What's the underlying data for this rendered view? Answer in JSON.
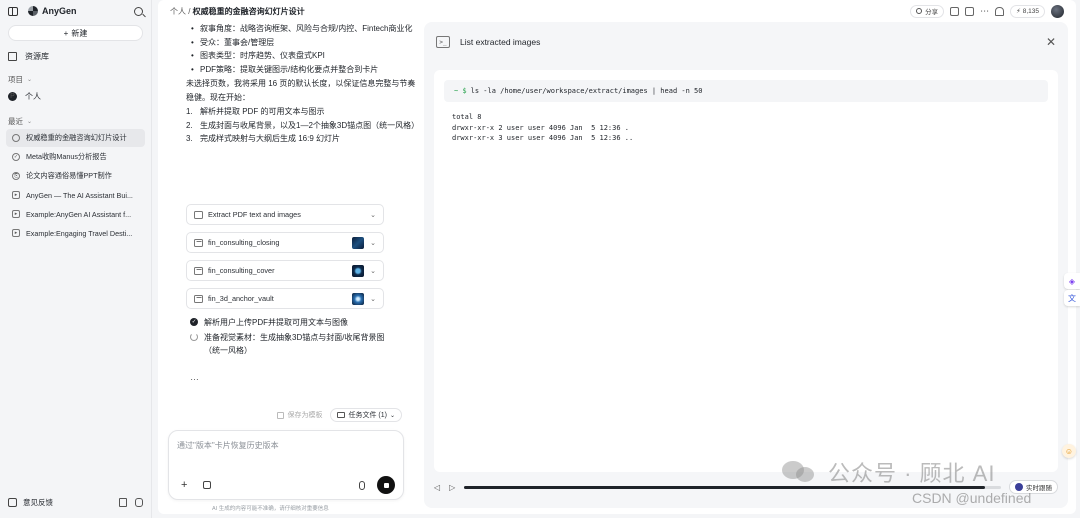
{
  "sidebar": {
    "brand": "AnyGen",
    "new_label": "新建",
    "library_label": "资源库",
    "projects_label": "项目",
    "personal_label": "个人",
    "recent_label": "最近",
    "recent_items": [
      {
        "label": "权威稳重的金融咨询幻灯片设计",
        "active": true
      },
      {
        "label": "Meta收购Manus分析报告"
      },
      {
        "label": "论文内容通俗易懂PPT制作"
      },
      {
        "label": "AnyGen — The AI Assistant Bui..."
      },
      {
        "label": "Example:AnyGen AI Assistant f..."
      },
      {
        "label": "Example:Engaging Travel Desti..."
      }
    ],
    "feedback_label": "意见反馈"
  },
  "header": {
    "breadcrumb_parent": "个人",
    "breadcrumb_sep": " / ",
    "breadcrumb_current": "权威稳重的金融咨询幻灯片设计",
    "share_label": "分享",
    "credits": "8,135"
  },
  "chat": {
    "bullets": [
      "叙事角度：战略咨询框架、风险与合规/内控、Fintech商业化",
      "受众：董事会/管理层",
      "图表类型：时序趋势、仪表盘式KPI",
      "PDF策略：提取关键图示/结构化要点并整合到卡片"
    ],
    "paragraph": "未选择页数，我将采用 16 页的默认长度，以保证信息完整与节奏稳健。现在开始：",
    "steps": [
      {
        "n": "1.",
        "text": "解析并提取 PDF 的可用文本与图示"
      },
      {
        "n": "2.",
        "text": "生成封面与收尾背景，以及1—2个抽象3D锚点图（统一风格）"
      },
      {
        "n": "3.",
        "text": "完成样式映射与大纲后生成 16:9 幻灯片"
      }
    ],
    "tool_cards": [
      {
        "label": "Extract PDF text and images",
        "icon": "terminal-icon"
      },
      {
        "label": "fin_consulting_closing",
        "icon": "image-icon"
      },
      {
        "label": "fin_consulting_cover",
        "icon": "image-icon"
      },
      {
        "label": "fin_3d_anchor_vault",
        "icon": "image-icon"
      }
    ],
    "progress": [
      {
        "text": "解析用户上传PDF并提取可用文本与图像",
        "status": "done"
      },
      {
        "text": "准备视觉素材：生成抽象3D锚点与封面/收尾背景图（统一风格）",
        "status": "in-progress"
      }
    ],
    "ellipsis": "…",
    "save_template": "保存为模板",
    "task_files": "任务文件 (1)",
    "composer_placeholder": "通过\"版本\"卡片恢复历史版本",
    "disclaimer": "AI 生成的内容可能不准确，请仔细核对重要信息"
  },
  "panel": {
    "title": "List extracted images",
    "prompt": "~ $",
    "command": "ls -la /home/user/workspace/extract/images | head -n 50",
    "output_lines": [
      "total 8",
      "drwxr-xr-x 2 user user 4096 Jan  5 12:36 .",
      "drwxr-xr-x 3 user user 4096 Jan  5 12:36 .."
    ],
    "playback_progress": 0.97,
    "live_label": "实时跟随"
  },
  "watermark": {
    "line1": "公众号 · 顾北 AI",
    "line2": "CSDN @undefined"
  }
}
